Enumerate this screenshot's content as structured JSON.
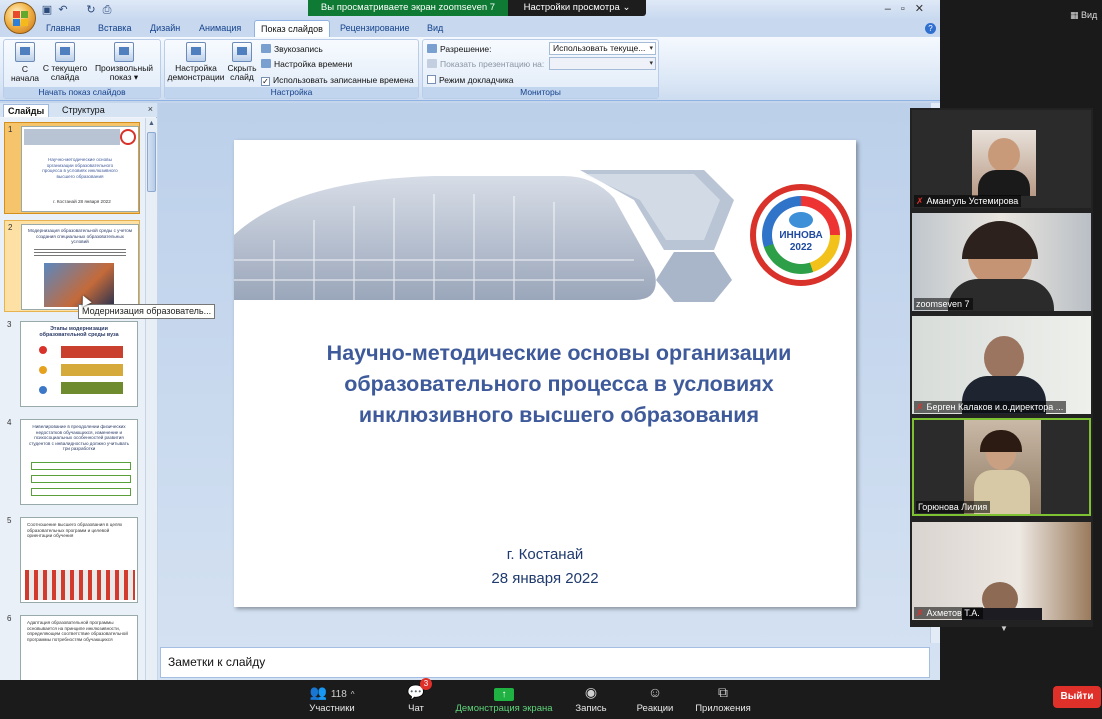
{
  "zoom": {
    "share_banner": "Вы просматриваете экран zoomseven 7",
    "view_options": "Настройки просмотра",
    "top_right_view": "Вид",
    "participants": [
      {
        "name": "Амангуль Устемирова",
        "muted": true
      },
      {
        "name": "zoomseven 7",
        "muted": false
      },
      {
        "name": "Берген Калаков и.о.директора ...",
        "muted": true
      },
      {
        "name": "Горюнова Лилия",
        "muted": false
      },
      {
        "name": "Ахметов Т.А.",
        "muted": true
      }
    ],
    "toolbar": {
      "participants_label": "Участники",
      "participants_count": "118",
      "chat_label": "Чат",
      "chat_badge": "3",
      "share_label": "Демонстрация экрана",
      "record_label": "Запись",
      "reactions_label": "Реакции",
      "apps_label": "Приложения",
      "leave_label": "Выйти"
    }
  },
  "ppt": {
    "tabs": [
      "Главная",
      "Вставка",
      "Дизайн",
      "Анимация",
      "Показ слайдов",
      "Рецензирование",
      "Вид"
    ],
    "active_tab": "Показ слайдов",
    "ribbon": {
      "group1": {
        "label": "Начать показ слайдов",
        "from_start": "С начала",
        "from_current_line1": "С текущего",
        "from_current_line2": "слайда",
        "custom_line1": "Произвольный",
        "custom_line2": "показ"
      },
      "group2": {
        "label": "Настройка",
        "setup_line1": "Настройка",
        "setup_line2": "демонстрации",
        "hide_line1": "Скрыть",
        "hide_line2": "слайд",
        "record_narration": "Звукозапись",
        "rehearse_timings": "Настройка времени",
        "use_timings": "Использовать записанные времена",
        "use_timings_checked": true
      },
      "group3": {
        "label": "Мониторы",
        "resolution_label": "Разрешение:",
        "resolution_value": "Использовать текуще...",
        "show_on_label": "Показать презентацию на:",
        "presenter_view": "Режим докладчика"
      }
    },
    "panel": {
      "tab_slides": "Слайды",
      "tab_outline": "Структура",
      "close": "×",
      "tooltip": "Модернизация образователь...",
      "thumbnails": [
        {
          "num": "1",
          "text": "Научно-методические основы организации образовательного процесса в условиях инклюзивного высшего образования",
          "sub": "г. Костанай 28 января 2022"
        },
        {
          "num": "2",
          "text": "Модернизация образовательной среды с учетом создания специальных образовательных условий",
          "sub": ""
        },
        {
          "num": "3",
          "text": "Этапы модернизации образовательной среды вуза",
          "sub": ""
        },
        {
          "num": "4",
          "text": "Нивелирование в преодолении физических недостатков обучающихся, изменение и психосоциальных особенностей развития студентов с инвалидностью должно учитывать три разработки",
          "sub": ""
        },
        {
          "num": "5",
          "text": "Соотношение высшего образования в целях образовательных программ и целевой ориентации обучения",
          "sub": ""
        },
        {
          "num": "6",
          "text": "Адаптация образовательной программы основывается на принципе инклюзивности, определяющем соответствие образовательной программы потребностям обучающихся",
          "sub": ""
        }
      ]
    },
    "slide": {
      "title": "Научно-методические основы организации образовательного процесса в условиях инклюзивного высшего образования",
      "city": "г. Костанай",
      "date": "28 января 2022",
      "logo_text": "ИННОВА",
      "logo_year": "2022"
    },
    "notes_placeholder": "Заметки к слайду"
  }
}
